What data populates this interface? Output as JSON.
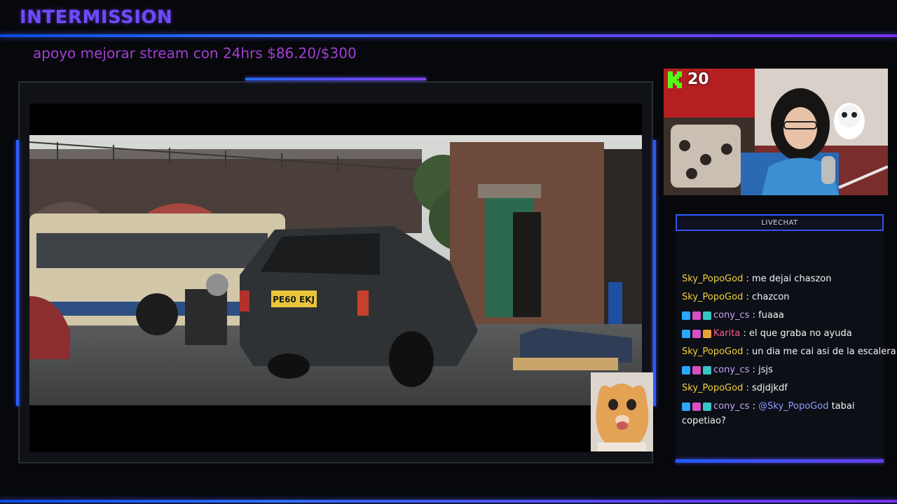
{
  "overlay": {
    "title": "INTERMISSION",
    "goal_text": "apoyo mejorar stream con 24hrs $86.20/$300"
  },
  "webcam": {
    "viewer_count": "20",
    "platform_icon": "kick-icon"
  },
  "chat": {
    "header": "LIVECHAT",
    "messages": [
      {
        "user": "Sky_PopoGod",
        "sep": " : ",
        "text": "me dejai chaszon",
        "color": "#f2cf3a",
        "badges": []
      },
      {
        "user": "Sky_PopoGod",
        "sep": " : ",
        "text": "chazcon",
        "color": "#f2cf3a",
        "badges": []
      },
      {
        "user": "cony_cs",
        "sep": " : ",
        "text": "fuaaa",
        "color": "#c9a2f5",
        "badges": [
          "sword-badge",
          "heart-badge",
          "sub-badge"
        ]
      },
      {
        "user": "Karita",
        "sep": " : ",
        "text": "el que graba no ayuda",
        "color": "#ff5a8a",
        "badges": [
          "sword-badge",
          "heart-badge",
          "crown-badge"
        ]
      },
      {
        "user": "Sky_PopoGod",
        "sep": " : ",
        "text": "un dia me cai asi de la escalera",
        "color": "#f2cf3a",
        "badges": []
      },
      {
        "user": "cony_cs",
        "sep": " : ",
        "text": "jsjs",
        "color": "#c9a2f5",
        "badges": [
          "sword-badge",
          "heart-badge",
          "sub-badge"
        ]
      },
      {
        "user": "Sky_PopoGod",
        "sep": " : ",
        "text": "sdjdjkdf",
        "color": "#f2cf3a",
        "badges": []
      },
      {
        "user": "cony_cs",
        "sep": " : ",
        "mention": "@Sky_PopoGod",
        "text": " tabai copetiao?",
        "color": "#c9a2f5",
        "badges": [
          "sword-badge",
          "heart-badge",
          "sub-badge"
        ]
      }
    ]
  },
  "video": {
    "plate": "PE60 EKJ"
  },
  "colors": {
    "accent_blue": "#2c5cff",
    "accent_purple": "#7a30f0",
    "title_purple": "#6f49ff",
    "goal_purple": "#a13fd3"
  }
}
